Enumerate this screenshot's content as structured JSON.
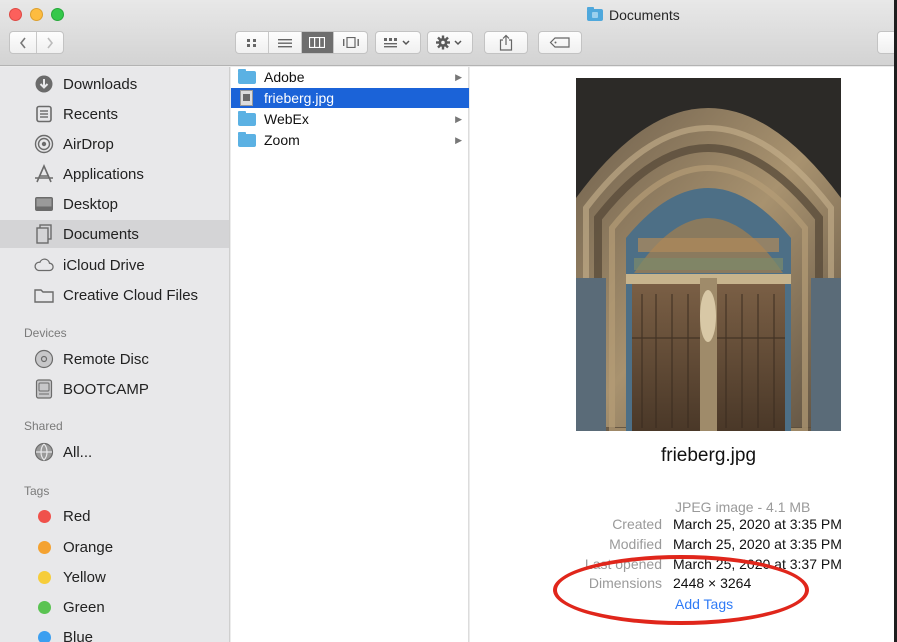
{
  "window": {
    "title": "Documents",
    "accent": "#1b63d8"
  },
  "toolbar": {
    "back_icon": "chevron-left-icon",
    "forward_icon": "chevron-right-icon",
    "view_modes": [
      "icon-view",
      "list-view",
      "column-view",
      "gallery-view"
    ],
    "selected_view": "column-view",
    "group_icon": "group-by-icon",
    "action_icon": "gear-icon",
    "share_icon": "share-icon",
    "tag_icon": "tag-icon"
  },
  "sidebar": {
    "favorites": [
      {
        "label": "Downloads",
        "icon": "download-icon"
      },
      {
        "label": "Recents",
        "icon": "recents-icon"
      },
      {
        "label": "AirDrop",
        "icon": "airdrop-icon"
      },
      {
        "label": "Applications",
        "icon": "applications-icon"
      },
      {
        "label": "Desktop",
        "icon": "desktop-icon"
      },
      {
        "label": "Documents",
        "icon": "documents-icon",
        "selected": true
      },
      {
        "label": "iCloud Drive",
        "icon": "cloud-icon"
      },
      {
        "label": "Creative Cloud Files",
        "icon": "folder-icon"
      }
    ],
    "devices_header": "Devices",
    "devices": [
      {
        "label": "Remote Disc",
        "icon": "disc-icon"
      },
      {
        "label": "BOOTCAMP",
        "icon": "drive-icon"
      }
    ],
    "shared_header": "Shared",
    "shared": [
      {
        "label": "All...",
        "icon": "network-icon"
      }
    ],
    "tags_header": "Tags",
    "tags": [
      {
        "label": "Red",
        "color": "#f0514b"
      },
      {
        "label": "Orange",
        "color": "#f4a231"
      },
      {
        "label": "Yellow",
        "color": "#f6cd3b"
      },
      {
        "label": "Green",
        "color": "#5ac352"
      },
      {
        "label": "Blue",
        "color": "#3c9ff0"
      }
    ]
  },
  "column1": {
    "items": [
      {
        "name": "Adobe",
        "kind": "folder",
        "has_children": true
      },
      {
        "name": "frieberg.jpg",
        "kind": "file",
        "selected": true
      },
      {
        "name": "WebEx",
        "kind": "folder",
        "has_children": true
      },
      {
        "name": "Zoom",
        "kind": "folder",
        "has_children": true
      }
    ]
  },
  "preview": {
    "file_name": "frieberg.jpg",
    "kind": "JPEG image - 4.1 MB",
    "created_label": "Created",
    "created_value": "March 25, 2020 at 3:35 PM",
    "modified_label": "Modified",
    "modified_value": "March 25, 2020 at 3:35 PM",
    "last_opened_label": "Last opened",
    "last_opened_value": "March 25, 2020 at 3:37 PM",
    "dimensions_label": "Dimensions",
    "dimensions_value": "2448 × 3264",
    "add_tags": "Add Tags",
    "annotation_color": "#e0261b"
  }
}
